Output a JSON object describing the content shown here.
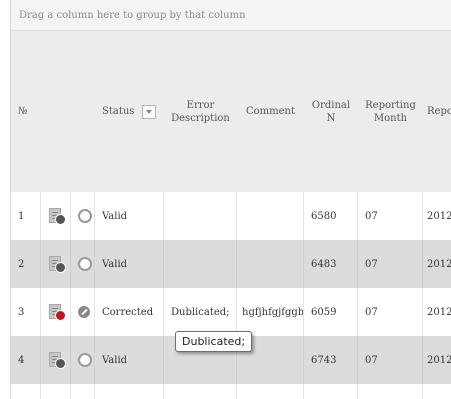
{
  "group_bar": {
    "text": "Drag a column here to group by that column"
  },
  "columns": {
    "number": "№",
    "status": "Status",
    "error_description": "Error Description",
    "comment": "Comment",
    "ordinal": "Ordinal N",
    "reporting_month": "Reporting Month",
    "reporting_year_partial": "Repo Ye"
  },
  "rows": [
    {
      "num": "1",
      "status": "Valid",
      "error": "",
      "comment": "",
      "ordinal": "6580",
      "month": "07",
      "year": "2012",
      "doc_badge": "normal",
      "state_icon": "circle-icon"
    },
    {
      "num": "2",
      "status": "Valid",
      "error": "",
      "comment": "",
      "ordinal": "6483",
      "month": "07",
      "year": "2012",
      "doc_badge": "normal",
      "state_icon": "circle-icon"
    },
    {
      "num": "3",
      "status": "Corrected",
      "error": "Dublicated;",
      "comment": "hgfjhfgjfggh",
      "ordinal": "6059",
      "month": "07",
      "year": "2012",
      "doc_badge": "error",
      "state_icon": "pencil-icon"
    },
    {
      "num": "4",
      "status": "Valid",
      "error": "",
      "comment": "",
      "ordinal": "6743",
      "month": "07",
      "year": "2012",
      "doc_badge": "normal",
      "state_icon": "circle-icon"
    }
  ],
  "tooltip": {
    "text": "Dublicated;"
  }
}
